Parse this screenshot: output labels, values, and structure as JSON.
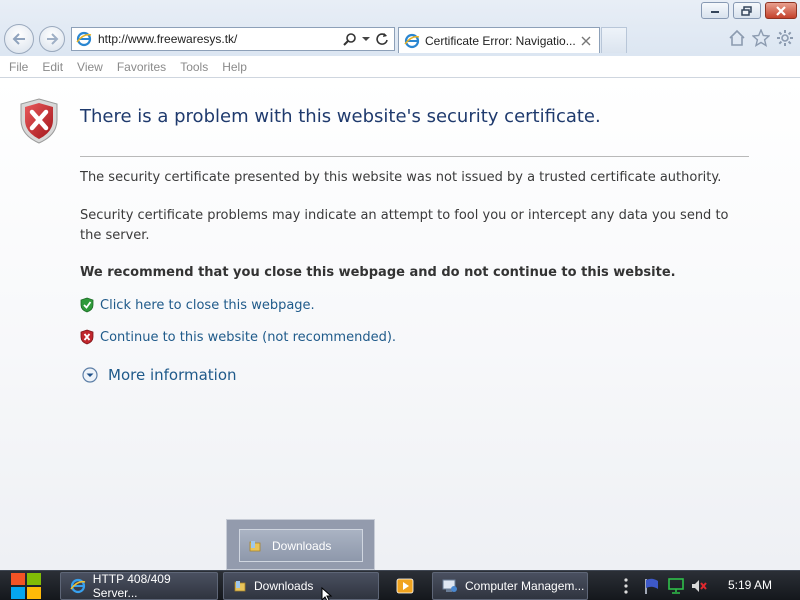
{
  "browser": {
    "address": "http://www.freewaresys.tk/",
    "tab_title": "Certificate Error: Navigatio..."
  },
  "menu": [
    "File",
    "Edit",
    "View",
    "Favorites",
    "Tools",
    "Help"
  ],
  "page": {
    "title": "There is a problem with this website's security certificate.",
    "para1": "The security certificate presented by this website was not issued by a trusted certificate authority.",
    "para2": "Security certificate problems may indicate an attempt to fool you or intercept any data you send to the server.",
    "recommend": "We recommend that you close this webpage and do not continue to this website.",
    "close_link": "Click here to close this webpage.",
    "continue_link": "Continue to this website (not recommended).",
    "more_info": "More information"
  },
  "taskbar": {
    "items": [
      "HTTP 408/409 Server...",
      "Downloads",
      "Computer Managem..."
    ],
    "preview_label": "Downloads",
    "clock": "5:19 AM"
  },
  "colors": {
    "title": "#1f3a6d",
    "link": "#1f5a8a",
    "shield_red": "#c0262c",
    "shield_green": "#2f9a3a",
    "taskbar": "#14171c"
  }
}
